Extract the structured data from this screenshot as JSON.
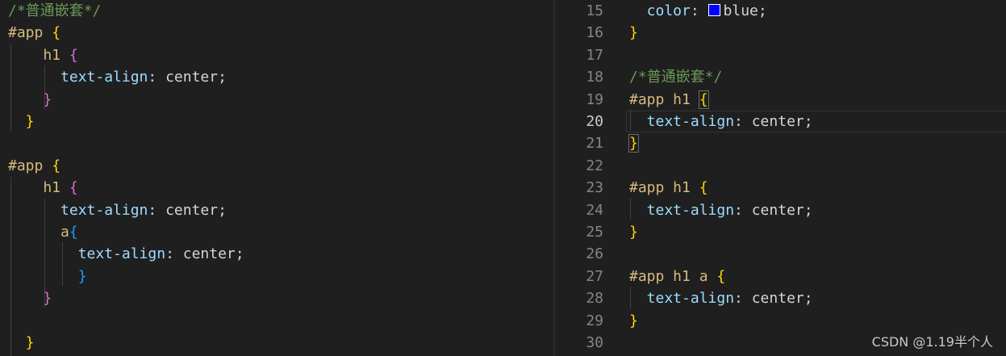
{
  "left": {
    "lines": [
      [
        {
          "t": "/*普通嵌套*/",
          "c": "comment"
        }
      ],
      [
        {
          "t": "#app ",
          "c": "sel"
        },
        {
          "t": "{",
          "c": "b1"
        }
      ],
      [
        {
          "t": "    h1 ",
          "c": "sel"
        },
        {
          "t": "{",
          "c": "b2"
        }
      ],
      [
        {
          "t": "      text-align",
          "c": "prop"
        },
        {
          "t": ": center;",
          "c": "val"
        }
      ],
      [
        {
          "t": "    }",
          "c": "b2"
        }
      ],
      [
        {
          "t": "  }",
          "c": "b1"
        }
      ],
      [],
      [
        {
          "t": "#app ",
          "c": "sel"
        },
        {
          "t": "{",
          "c": "b1"
        }
      ],
      [
        {
          "t": "    h1 ",
          "c": "sel"
        },
        {
          "t": "{",
          "c": "b2"
        }
      ],
      [
        {
          "t": "      text-align",
          "c": "prop"
        },
        {
          "t": ": center;",
          "c": "val"
        }
      ],
      [
        {
          "t": "      a",
          "c": "sel"
        },
        {
          "t": "{",
          "c": "b3"
        }
      ],
      [
        {
          "t": "        text-align",
          "c": "prop"
        },
        {
          "t": ": center;",
          "c": "val"
        }
      ],
      [
        {
          "t": "        }",
          "c": "b3"
        }
      ],
      [
        {
          "t": "    }",
          "c": "b2"
        }
      ],
      [],
      [
        {
          "t": "  }",
          "c": "b1"
        }
      ]
    ]
  },
  "right": {
    "active_line": "20",
    "lines": [
      {
        "n": "15",
        "tokens": [
          {
            "t": "  color",
            "c": "prop"
          },
          {
            "t": ": ",
            "c": "val"
          },
          {
            "t": "",
            "c": "swatch"
          },
          {
            "t": "blue;",
            "c": "val"
          }
        ]
      },
      {
        "n": "16",
        "tokens": [
          {
            "t": "}",
            "c": "b1"
          }
        ]
      },
      {
        "n": "17",
        "tokens": []
      },
      {
        "n": "18",
        "tokens": [
          {
            "t": "/*普通嵌套*/",
            "c": "comment"
          }
        ]
      },
      {
        "n": "19",
        "tokens": [
          {
            "t": "#app h1 ",
            "c": "sel"
          },
          {
            "t": "{",
            "c": "b1box"
          }
        ]
      },
      {
        "n": "20",
        "tokens": [
          {
            "t": "  text-align",
            "c": "prop"
          },
          {
            "t": ": center;",
            "c": "val"
          }
        ]
      },
      {
        "n": "21",
        "tokens": [
          {
            "t": "}",
            "c": "b1box"
          }
        ]
      },
      {
        "n": "22",
        "tokens": []
      },
      {
        "n": "23",
        "tokens": [
          {
            "t": "#app h1 ",
            "c": "sel"
          },
          {
            "t": "{",
            "c": "b1"
          }
        ]
      },
      {
        "n": "24",
        "tokens": [
          {
            "t": "  text-align",
            "c": "prop"
          },
          {
            "t": ": center;",
            "c": "val"
          }
        ]
      },
      {
        "n": "25",
        "tokens": [
          {
            "t": "}",
            "c": "b1"
          }
        ]
      },
      {
        "n": "26",
        "tokens": []
      },
      {
        "n": "27",
        "tokens": [
          {
            "t": "#app h1 a ",
            "c": "sel"
          },
          {
            "t": "{",
            "c": "b1"
          }
        ]
      },
      {
        "n": "28",
        "tokens": [
          {
            "t": "  text-align",
            "c": "prop"
          },
          {
            "t": ": center;",
            "c": "val"
          }
        ]
      },
      {
        "n": "29",
        "tokens": [
          {
            "t": "}",
            "c": "b1"
          }
        ]
      },
      {
        "n": "30",
        "tokens": []
      }
    ]
  },
  "swatch_color": "#0000ff",
  "watermark": "CSDN @1.19半个人"
}
